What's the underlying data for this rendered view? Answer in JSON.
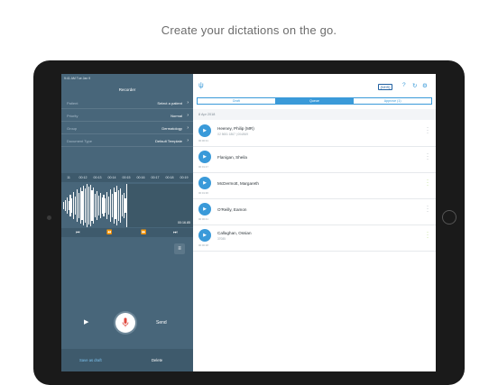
{
  "headline": "Create your dictations on the go.",
  "status_bar": {
    "left": "9:41 AM   Tue Jan 9"
  },
  "recorder": {
    "title": "Recorder",
    "fields": [
      {
        "label": "Patient",
        "value": "Select a patient"
      },
      {
        "label": "Priority",
        "value": "Normal"
      },
      {
        "label": "Group",
        "value": "Dermatology"
      },
      {
        "label": "Document Type",
        "value": "Default Template"
      }
    ],
    "timeline": [
      "11",
      "00:12",
      "00:13",
      "00:14",
      "00:15",
      "00:16",
      "00:17",
      "00:18",
      "00:19",
      "00"
    ],
    "time_readout": "00:16.85",
    "transport": {
      "start": "⏮",
      "rewind": "⏪",
      "forward": "⏩",
      "end": "⏭"
    },
    "play_label": "▶",
    "send_label": "Send",
    "save_draft_label": "Save as draft",
    "delete_label": "Delete",
    "accent_color": "#48667a"
  },
  "toolbar": {
    "logo": "ψ",
    "nhs_badge": "{NHS}",
    "icons": [
      "help-icon",
      "refresh-icon",
      "settings-icon"
    ]
  },
  "segments": [
    {
      "label": "Draft",
      "active": false
    },
    {
      "label": "Queue",
      "active": true
    },
    {
      "label": "Approve (1)",
      "active": false
    }
  ],
  "date_header": "8 Apr 2018",
  "dictations": [
    {
      "name": "Heeney, Philip (MR)",
      "sub": "X2 5651 1867 | 004/849",
      "duration": "00:00:31",
      "menu_green": false
    },
    {
      "name": "Flanigan, Sheila",
      "sub": "",
      "duration": "00:01:47",
      "menu_green": false
    },
    {
      "name": "McDermott, Margareth",
      "sub": "",
      "duration": "00:01:36",
      "menu_green": true
    },
    {
      "name": "O'Reilly, Eamon",
      "sub": "",
      "duration": "00:00:41",
      "menu_green": false
    },
    {
      "name": "Callaghan, Ossian",
      "sub": "37085",
      "duration": "00:00:38",
      "menu_green": true
    }
  ]
}
